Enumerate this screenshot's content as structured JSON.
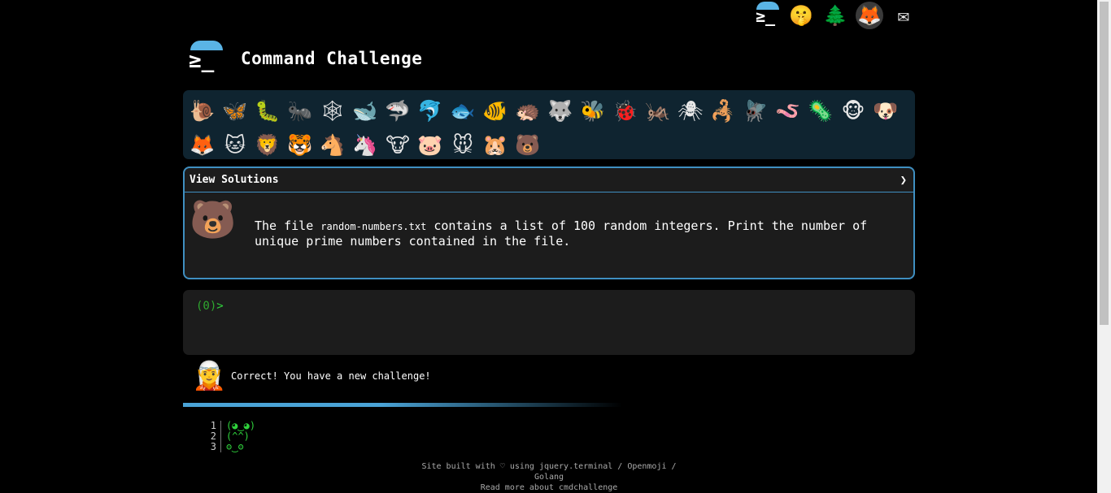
{
  "top_icons": [
    {
      "name": "cmdchallenge-logo",
      "glyph": "≥_"
    },
    {
      "name": "emoji-face-icon",
      "glyph": "🤫"
    },
    {
      "name": "tree-icon",
      "glyph": "🌲"
    },
    {
      "name": "gitlab-icon",
      "glyph": "🦊"
    },
    {
      "name": "mail-icon",
      "glyph": "✉"
    }
  ],
  "header": {
    "title": "Command Challenge",
    "logo_prompt": "≥_"
  },
  "animals": [
    {
      "name": "snail",
      "glyph": "🐌"
    },
    {
      "name": "butterfly",
      "glyph": "🦋"
    },
    {
      "name": "caterpillar",
      "glyph": "🐛"
    },
    {
      "name": "ant",
      "glyph": "🐜"
    },
    {
      "name": "spider-web",
      "glyph": "🕸"
    },
    {
      "name": "whale",
      "glyph": "🐋"
    },
    {
      "name": "shark",
      "glyph": "🦈"
    },
    {
      "name": "dolphin",
      "glyph": "🐬"
    },
    {
      "name": "fish",
      "glyph": "🐟"
    },
    {
      "name": "tropical-fish",
      "glyph": "🐠"
    },
    {
      "name": "hedgehog",
      "glyph": "🦔"
    },
    {
      "name": "wolf",
      "glyph": "🐺"
    },
    {
      "name": "bee",
      "glyph": "🐝"
    },
    {
      "name": "ladybug",
      "glyph": "🐞"
    },
    {
      "name": "cricket",
      "glyph": "🦗"
    },
    {
      "name": "spider",
      "glyph": "🕷"
    },
    {
      "name": "scorpion",
      "glyph": "🦂"
    },
    {
      "name": "fly",
      "glyph": "🪰"
    },
    {
      "name": "worm",
      "glyph": "🪱"
    },
    {
      "name": "microbe",
      "glyph": "🦠"
    },
    {
      "name": "monkey",
      "glyph": "🐵"
    },
    {
      "name": "dog",
      "glyph": "🐶"
    },
    {
      "name": "fox",
      "glyph": "🦊"
    },
    {
      "name": "cat",
      "glyph": "🐱"
    },
    {
      "name": "lion",
      "glyph": "🦁"
    },
    {
      "name": "tiger",
      "glyph": "🐯"
    },
    {
      "name": "horse",
      "glyph": "🐴"
    },
    {
      "name": "unicorn",
      "glyph": "🦄"
    },
    {
      "name": "cow",
      "glyph": "🐮"
    },
    {
      "name": "pig",
      "glyph": "🐷"
    },
    {
      "name": "mouse",
      "glyph": "🐭"
    },
    {
      "name": "hamster",
      "glyph": "🐹"
    },
    {
      "name": "bear",
      "glyph": "🐻"
    }
  ],
  "challenge": {
    "header_label": "View Solutions",
    "chevron": "❯",
    "icon": "🐻",
    "text_before": "The file ",
    "file_name": "random-numbers.txt",
    "text_after": " contains a list of 100 random integers. Print the number of unique prime numbers contained in the file."
  },
  "terminal": {
    "prompt_count": "(0)",
    "prompt_symbol": ">"
  },
  "status": {
    "icon": "🧝",
    "message": "Correct! You have a new challenge!"
  },
  "progress": {
    "fraction": 0.45
  },
  "lines": [
    {
      "num": "1",
      "text": "(◕‿◕)"
    },
    {
      "num": "2",
      "text": "(^^)"
    },
    {
      "num": "3",
      "text": "ʘ‿ʘ"
    }
  ],
  "footer": {
    "line1": "Site built with ♡ using jquery.terminal / Openmoji / Golang",
    "line2": "Read more about cmdchallenge"
  },
  "colors": {
    "background": "#000000",
    "accent": "#3f8fc1",
    "terminal_green": "#2fd13c",
    "panel_bg": "#1c1c1c",
    "animal_bar_bg": "#0f2430"
  }
}
